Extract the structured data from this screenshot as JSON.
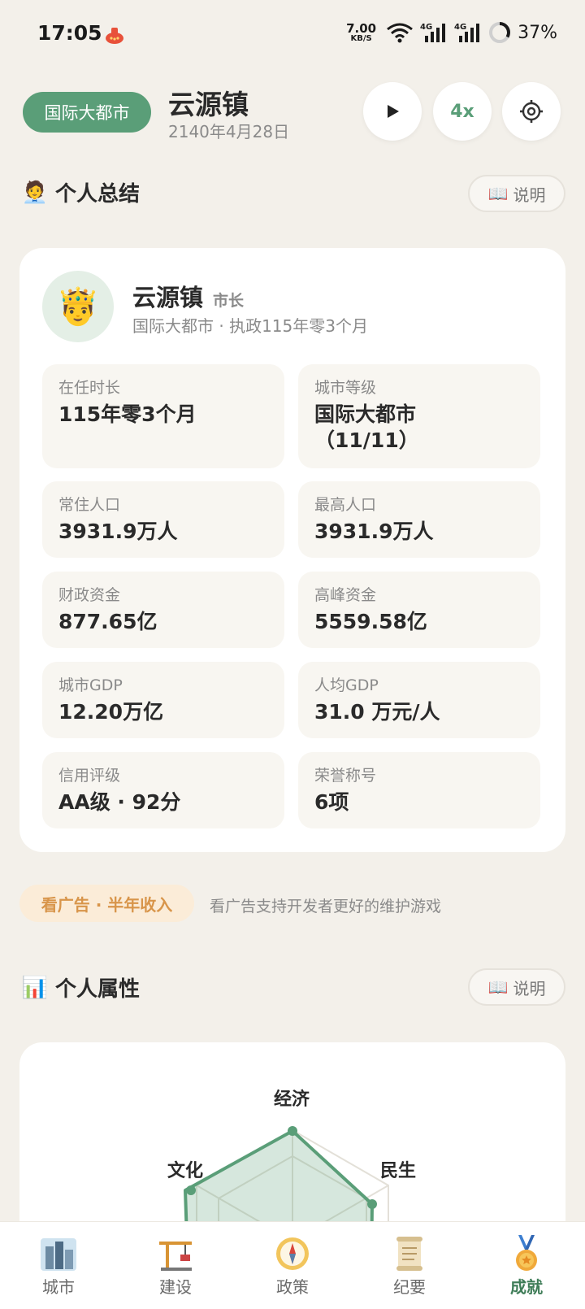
{
  "status_bar": {
    "time": "17:05",
    "net_speed_value": "7.00",
    "net_speed_unit": "KB/S",
    "battery": "37%",
    "icons": [
      "notification-icon",
      "wifi-icon",
      "signal-4g-icon",
      "signal-4g-icon",
      "battery-ring-icon"
    ]
  },
  "header": {
    "level_pill": "国际大都市",
    "city_name": "云源镇",
    "date": "2140年4月28日",
    "play_icon": "play-icon",
    "speed": "4x",
    "settings_icon": "gear-icon"
  },
  "summary_section": {
    "emoji": "🧑‍💼",
    "title": "个人总结",
    "help_icon": "📖",
    "help_label": "说明"
  },
  "profile": {
    "avatar": "🤴",
    "name": "云源镇",
    "role": "市长",
    "subtitle": "国际大都市 · 执政115年零3个月"
  },
  "stats": [
    {
      "label": "在任时长",
      "value": "115年零3个月"
    },
    {
      "label": "城市等级",
      "value": "国际大都市\n（11/11）"
    },
    {
      "label": "常住人口",
      "value": "3931.9万人"
    },
    {
      "label": "最高人口",
      "value": "3931.9万人"
    },
    {
      "label": "财政资金",
      "value": "877.65亿"
    },
    {
      "label": "高峰资金",
      "value": "5559.58亿"
    },
    {
      "label": "城市GDP",
      "value": "12.20万亿"
    },
    {
      "label": "人均GDP",
      "value": "31.0 万元/人"
    },
    {
      "label": "信用评级",
      "value": "AA级 · 92分"
    },
    {
      "label": "荣誉称号",
      "value": "6项"
    }
  ],
  "ad": {
    "button": "看广告 · 半年收入",
    "note": "看广告支持开发者更好的维护游戏"
  },
  "attributes_section": {
    "emoji": "📊",
    "title": "个人属性",
    "help_icon": "📖",
    "help_label": "说明"
  },
  "radar": {
    "axes": [
      "经济",
      "民生",
      "文化"
    ],
    "colors": {
      "fill": "#5a9e78",
      "grid": "#e3e0d8"
    }
  },
  "bottom_nav": [
    {
      "label": "城市",
      "icon": "city-icon",
      "active": false
    },
    {
      "label": "建设",
      "icon": "crane-icon",
      "active": false
    },
    {
      "label": "政策",
      "icon": "compass-icon",
      "active": false
    },
    {
      "label": "纪要",
      "icon": "scroll-icon",
      "active": false
    },
    {
      "label": "成就",
      "icon": "medal-icon",
      "active": true
    }
  ]
}
